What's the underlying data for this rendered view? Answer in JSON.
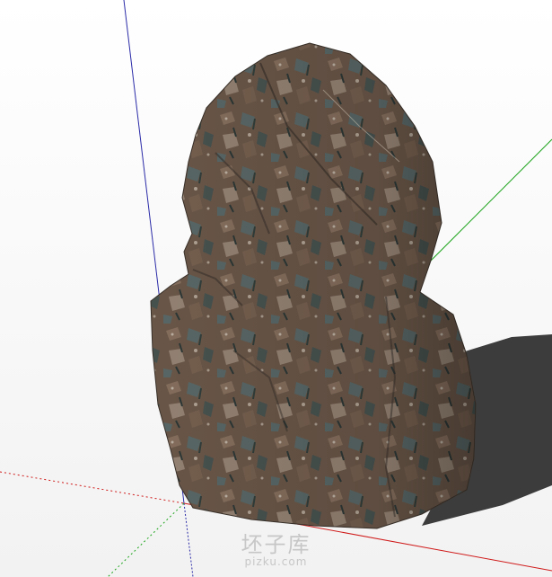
{
  "viewport": {
    "background": "#ffffff",
    "axes": {
      "red_axis_color": "#d01a1a",
      "green_axis_color": "#1fa41f",
      "blue_axis_color": "#2a2aa8"
    },
    "model": {
      "name": "rock",
      "texture_colors": [
        "#6e5a4b",
        "#8a7260",
        "#5c6b6a",
        "#4a5552",
        "#9a8878"
      ],
      "shadow_color": "#3c3c3c"
    }
  },
  "watermark": {
    "main_text": "坯子库",
    "sub_text": "pizku.com"
  }
}
